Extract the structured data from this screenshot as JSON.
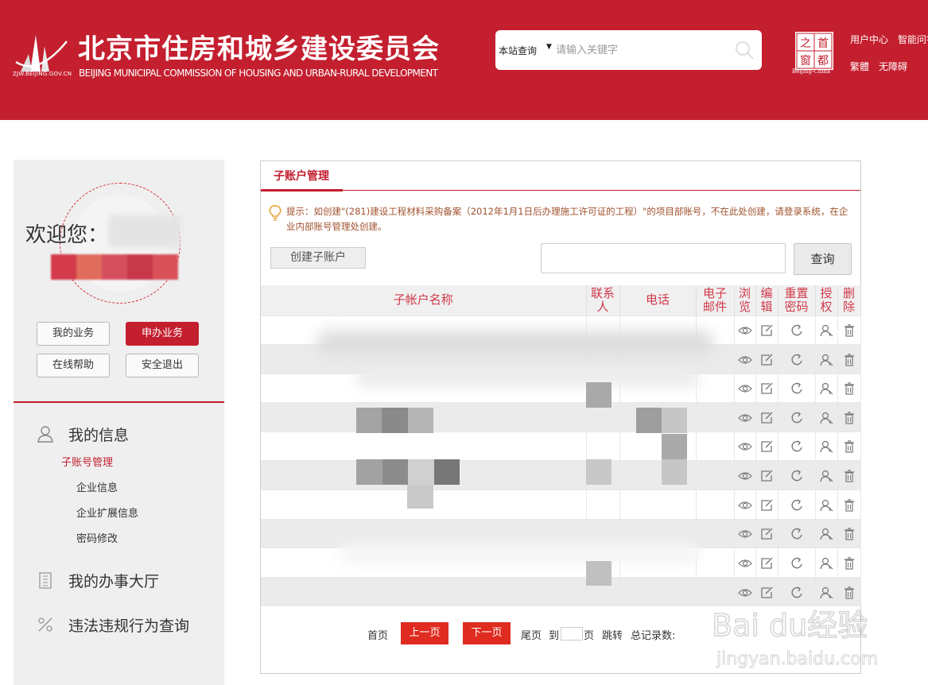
{
  "header": {
    "domain": "ZJW.BEIJING.GOV.CN",
    "title": "北京市住房和城乡建设委员会",
    "subtitle": "BEIJING MUNICIPAL COMMISSION OF HOUSING AND URBAN-RURAL DEVELOPMENT",
    "search_scope": "本站查询",
    "search_placeholder": "请输入关键字",
    "seal_chars": [
      "之",
      "首",
      "窗",
      "都"
    ],
    "seal_caption": "Beijing-China",
    "links": [
      "用户中心",
      "智能问答",
      "繁體",
      "无障碍"
    ],
    "brand_color": "#c41f2f"
  },
  "sidebar": {
    "welcome": "欢迎您：",
    "buttons": [
      "我的业务",
      "申办业务",
      "在线帮助",
      "安全退出"
    ],
    "sections": [
      {
        "label": "我的信息",
        "icon": "user-icon",
        "items": [
          "子账号管理",
          "企业信息",
          "企业扩展信息",
          "密码修改"
        ],
        "active_item": "子账号管理"
      },
      {
        "label": "我的办事大厅",
        "icon": "building-icon"
      },
      {
        "label": "违法违规行为查询",
        "icon": "percent-icon"
      }
    ]
  },
  "panel": {
    "tab": "子账户管理",
    "tip": "提示：如创建\"(281)建设工程材料采购备案（2012年1月1日后办理施工许可证的工程）\"的项目部账号，不在此处创建，请登录系统，在企业内部账号管理处创建。",
    "create_button": "创建子账户",
    "query_button": "查询",
    "query_value": "",
    "columns": [
      "子帐户名称",
      "联系人",
      "电话",
      "电子邮件",
      "浏览",
      "编辑",
      "重置密码",
      "授权",
      "删除"
    ],
    "row_count": 10,
    "row_actions": [
      "eye-icon",
      "edit-icon",
      "reset-icon",
      "authorize-icon",
      "delete-icon"
    ]
  },
  "pager": {
    "first": "首页",
    "prev": "上一页",
    "next": "下一页",
    "last": "尾页",
    "goto": "到",
    "page_unit": "页",
    "jump": "跳转",
    "total": "总记录数:"
  },
  "watermark": {
    "brand": "Bai du经验",
    "url": "jingyan.baidu.com"
  }
}
